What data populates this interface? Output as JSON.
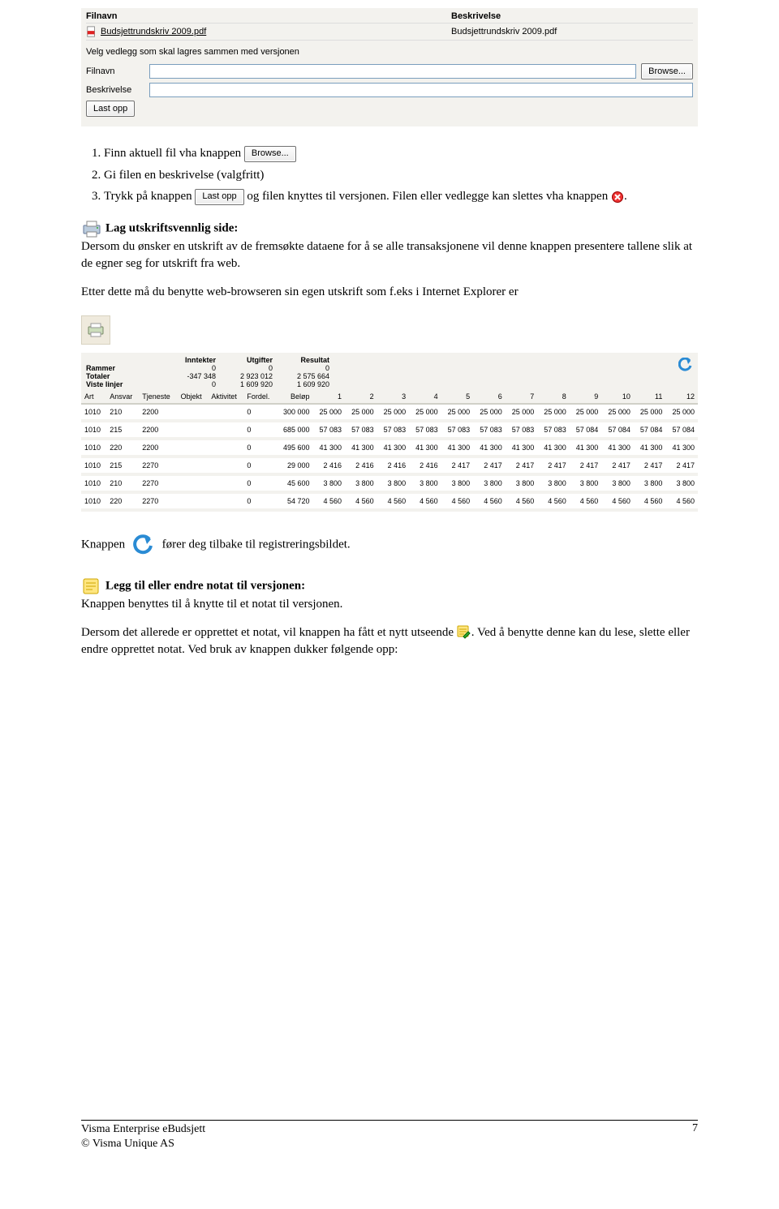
{
  "upload": {
    "header_filnavn": "Filnavn",
    "header_beskrivelse": "Beskrivelse",
    "file_link": "Budsjettrundskriv 2009.pdf",
    "file_desc": "Budsjettrundskriv 2009.pdf",
    "prompt": "Velg vedlegg som skal lagres sammen med versjonen",
    "lbl_filnavn": "Filnavn",
    "lbl_beskrivelse": "Beskrivelse",
    "btn_browse": "Browse...",
    "btn_lastopp": "Last opp"
  },
  "steps": {
    "s1a": "Finn aktuell fil vha knappen ",
    "s2": "Gi filen en beskrivelse (valgfritt)",
    "s3a": "Trykk på knappen ",
    "s3b": " og filen knyttes til versjonen. Filen eller vedlegge kan slettes vha knappen ",
    "s3c": "."
  },
  "print_section": {
    "title": "Lag utskriftsvennlig side:",
    "body": "Dersom du ønsker en utskrift av de fremsøkte dataene for å se alle transaksjonene vil denne knappen presentere tallene slik at de egner seg for utskrift fra web.",
    "after": "Etter dette må du benytte web-browseren sin egen utskrift som f.eks i Internet Explorer er"
  },
  "summary": {
    "h_inntekter": "Inntekter",
    "h_utgifter": "Utgifter",
    "h_resultat": "Resultat",
    "rows": [
      {
        "label": "Rammer",
        "i": "0",
        "u": "0",
        "r": "0"
      },
      {
        "label": "Totaler",
        "i": "-347 348",
        "u": "2 923 012",
        "r": "2 575 664"
      },
      {
        "label": "Viste linjer",
        "i": "0",
        "u": "1 609 920",
        "r": "1 609 920"
      }
    ]
  },
  "table": {
    "headers": [
      "Art",
      "Ansvar",
      "Tjeneste",
      "Objekt",
      "Aktivitet",
      "Fordel.",
      "Beløp",
      "1",
      "2",
      "3",
      "4",
      "5",
      "6",
      "7",
      "8",
      "9",
      "10",
      "11",
      "12"
    ],
    "rows": [
      [
        "1010",
        "210",
        "2200",
        "",
        "",
        "0",
        "300 000",
        "25 000",
        "25 000",
        "25 000",
        "25 000",
        "25 000",
        "25 000",
        "25 000",
        "25 000",
        "25 000",
        "25 000",
        "25 000",
        "25 000"
      ],
      [
        "1010",
        "215",
        "2200",
        "",
        "",
        "0",
        "685 000",
        "57 083",
        "57 083",
        "57 083",
        "57 083",
        "57 083",
        "57 083",
        "57 083",
        "57 083",
        "57 084",
        "57 084",
        "57 084",
        "57 084"
      ],
      [
        "1010",
        "220",
        "2200",
        "",
        "",
        "0",
        "495 600",
        "41 300",
        "41 300",
        "41 300",
        "41 300",
        "41 300",
        "41 300",
        "41 300",
        "41 300",
        "41 300",
        "41 300",
        "41 300",
        "41 300"
      ],
      [
        "1010",
        "215",
        "2270",
        "",
        "",
        "0",
        "29 000",
        "2 416",
        "2 416",
        "2 416",
        "2 416",
        "2 417",
        "2 417",
        "2 417",
        "2 417",
        "2 417",
        "2 417",
        "2 417",
        "2 417"
      ],
      [
        "1010",
        "210",
        "2270",
        "",
        "",
        "0",
        "45 600",
        "3 800",
        "3 800",
        "3 800",
        "3 800",
        "3 800",
        "3 800",
        "3 800",
        "3 800",
        "3 800",
        "3 800",
        "3 800",
        "3 800"
      ],
      [
        "1010",
        "220",
        "2270",
        "",
        "",
        "0",
        "54 720",
        "4 560",
        "4 560",
        "4 560",
        "4 560",
        "4 560",
        "4 560",
        "4 560",
        "4 560",
        "4 560",
        "4 560",
        "4 560",
        "4 560"
      ]
    ]
  },
  "back_line": {
    "a": "Knappen ",
    "b": " fører deg tilbake til registreringsbildet."
  },
  "note_section": {
    "title": "Legg til eller endre notat til versjonen:",
    "line1": "Knappen benyttes til å knytte til et notat til versjonen.",
    "line2a": "Dersom det allerede er opprettet et notat, vil knappen ha fått et nytt utseende",
    "line2b": ". Ved å benytte denne kan du lese, slette eller endre opprettet notat. Ved bruk av knappen dukker følgende opp:"
  },
  "footer": {
    "l1": "Visma Enterprise eBudsjett",
    "l2": "© Visma Unique AS",
    "page": "7"
  }
}
